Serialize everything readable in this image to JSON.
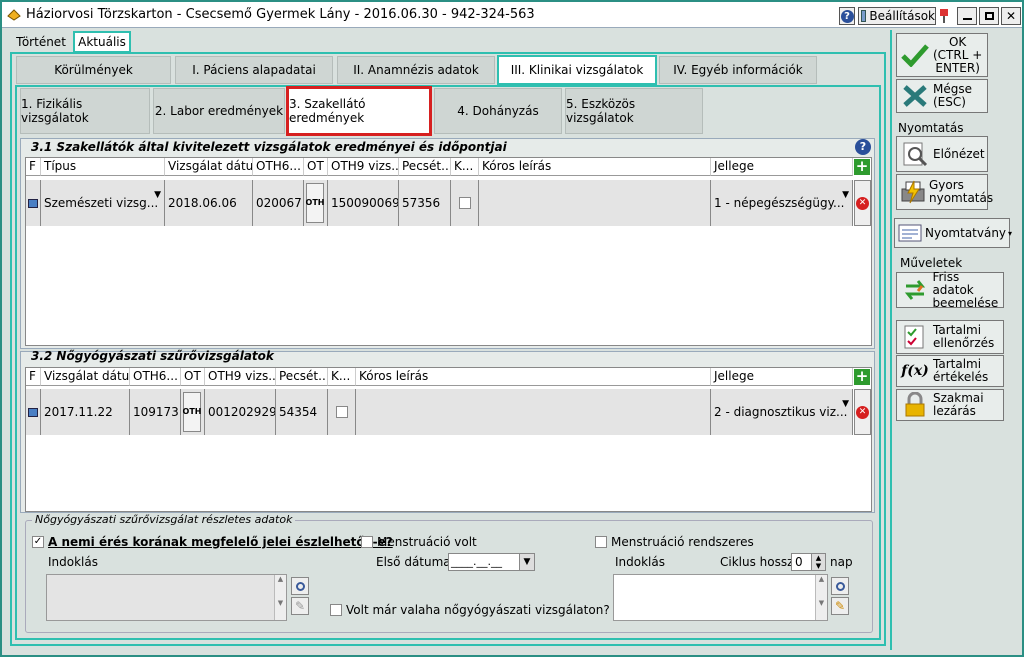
{
  "window": {
    "title": "Háziorvosi Törzskarton - Csecsemő Gyermek Lány - 2016.06.30 - 942-324-563",
    "settings_label": "Beállítások"
  },
  "top_tabs": [
    {
      "label": "Történet"
    },
    {
      "label": "Aktuális"
    }
  ],
  "main_tabs": [
    {
      "label": "Körülmények"
    },
    {
      "label": "I. Páciens alapadatai"
    },
    {
      "label": "II. Anamnézis adatok"
    },
    {
      "label": "III. Klinikai vizsgálatok"
    },
    {
      "label": "IV. Egyéb információk"
    }
  ],
  "sub_tabs": [
    {
      "label": "1. Fizikális vizsgálatok"
    },
    {
      "label": "2. Labor eredmények"
    },
    {
      "label": "3. Szakellátó eredmények"
    },
    {
      "label": "4. Dohányzás"
    },
    {
      "label": "5. Eszközös vizsgálatok"
    }
  ],
  "section1": {
    "title": "3.1 Szakellátók által kivitelezett vizsgálatok eredményei és időpontjai",
    "headers": [
      "F",
      "Típus",
      "Vizsgálat dátu...",
      "OTH6...",
      "OT",
      "OTH9 vizs...",
      "Pecsét...",
      "K...",
      "Kóros leírás",
      "Jellege"
    ],
    "row": {
      "tipus": "Szemészeti vizsg...",
      "datum": "2018.06.06",
      "oth6": "020067",
      "ot": "OTH",
      "oth9": "150090069",
      "pecset": "57356",
      "koros": "",
      "jellege": "1 - népegészségügy..."
    }
  },
  "section2": {
    "title": "3.2 Nőgyógyászati szűrővizsgálatok",
    "headers": [
      "F",
      "Vizsgálat dátu...",
      "OTH6...",
      "OT",
      "OTH9 vizs...",
      "Pecsét...",
      "K...",
      "Kóros leírás",
      "Jellege"
    ],
    "row": {
      "datum": "2017.11.22",
      "oth6": "109173",
      "ot": "OTH",
      "oth9": "001202929",
      "pecset": "54354",
      "koros": "",
      "jellege": "2 - diagnosztikus viz..."
    }
  },
  "details": {
    "legend": "Nőgyógyászati szűrővizsgálat részletes adatok",
    "q_signs": "A nemi érés korának megfelelő jelei észlelhetők-e?",
    "q_signs_checked": true,
    "indoklas_label": "Indoklás",
    "menstruacio_volt": "Menstruáció volt",
    "elso_datuma_label": "Első dátuma",
    "elso_datuma_value": "____.__.__",
    "menstruacio_rendszeres": "Menstruáció rendszeres",
    "indoklas2_label": "Indoklás",
    "ciklus_label": "Ciklus hossza",
    "ciklus_value": "0",
    "nap_label": "nap",
    "volt_mar": "Volt már valaha nőgyógyászati vizsgálaton?"
  },
  "right_panel": {
    "ok_label": "OK\n(CTRL +\nENTER)",
    "cancel_label": "Mégse\n(ESC)",
    "nyomtatas_label": "Nyomtatás",
    "elonezet_label": "Előnézet",
    "gyors_label": "Gyors\nnyomtatás",
    "nyomtatvany_label": "Nyomtatvány",
    "muveletek_label": "Műveletek",
    "friss_label": "Friss adatok\nbeemelése",
    "tartalmi_ell_label": "Tartalmi\nellenőrzés",
    "tartalmi_ert_label": "Tartalmi\nértékelés",
    "szakmai_label": "Szakmai\nlezárás"
  },
  "colors": {
    "accent": "#2fbfb0",
    "highlight_red": "#d62020",
    "green": "#2e9b2e"
  }
}
